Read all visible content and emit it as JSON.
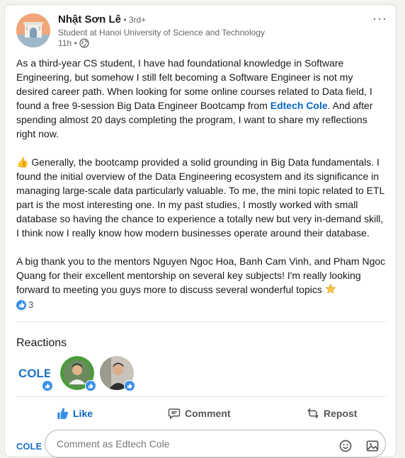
{
  "author": {
    "name": "Nhật Sơn Lê",
    "degree": " • 3rd+",
    "headline": "Student at Hanoi University of Science and Technology",
    "time": "11h •"
  },
  "post": {
    "p1_part1": "As a third-year CS student, I have had foundational knowledge in Software Engineering, but somehow I still felt becoming a Software Engineer is not my desired career path. When looking for some online courses related to Data field, I found a free 9-session Big Data Engineer Bootcamp from ",
    "p1_link": "Edtech Cole",
    "p1_part2": ". And after spending almost 20 days completing the program, I want to share my reflections right now.",
    "p2_emoji": "👍",
    "p2": " Generally, the bootcamp provided a solid grounding in Big Data fundamentals. I found the initial overview of the Data Engineering ecosystem and its significance in managing large-scale data particularly valuable. To me, the mini topic related to ETL part is the most interesting one. In my past studies, I mostly worked with small database so having the chance to experience a totally new but very in-demand skill, I think now I really know how modern businesses operate around their database.",
    "p3": "A big thank you to the mentors Nguyen Ngoc Hoa, Banh Cam Vinh, and Pham Ngoc Quang for their excellent mentorship on several key subjects! I'm really looking forward to meeting you guys more to discuss several wonderful topics "
  },
  "reactions": {
    "count": "3",
    "title": "Reactions",
    "logo_text": "COLE"
  },
  "actions": {
    "like": "Like",
    "comment": "Comment",
    "repost": "Repost"
  },
  "comment_box": {
    "placeholder": "Comment as Edtech Cole"
  },
  "colors": {
    "accent": "#0a66c2",
    "like_blue": "#378fe9"
  }
}
